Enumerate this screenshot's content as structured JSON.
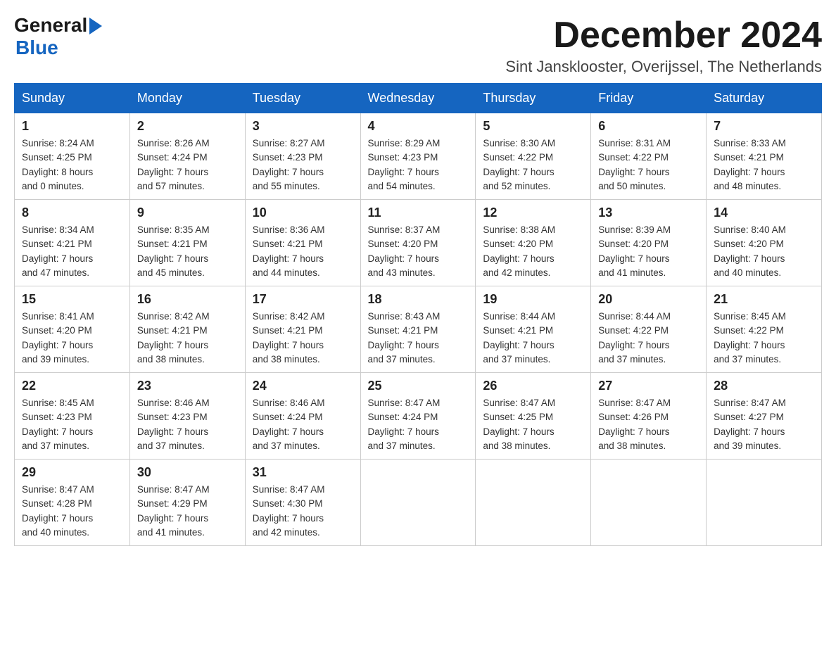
{
  "header": {
    "logo_general": "General",
    "logo_blue": "Blue",
    "month_title": "December 2024",
    "subtitle": "Sint Jansklooster, Overijssel, The Netherlands"
  },
  "days_of_week": [
    "Sunday",
    "Monday",
    "Tuesday",
    "Wednesday",
    "Thursday",
    "Friday",
    "Saturday"
  ],
  "weeks": [
    [
      {
        "day": "1",
        "sunrise": "8:24 AM",
        "sunset": "4:25 PM",
        "daylight": "8 hours and 0 minutes."
      },
      {
        "day": "2",
        "sunrise": "8:26 AM",
        "sunset": "4:24 PM",
        "daylight": "7 hours and 57 minutes."
      },
      {
        "day": "3",
        "sunrise": "8:27 AM",
        "sunset": "4:23 PM",
        "daylight": "7 hours and 55 minutes."
      },
      {
        "day": "4",
        "sunrise": "8:29 AM",
        "sunset": "4:23 PM",
        "daylight": "7 hours and 54 minutes."
      },
      {
        "day": "5",
        "sunrise": "8:30 AM",
        "sunset": "4:22 PM",
        "daylight": "7 hours and 52 minutes."
      },
      {
        "day": "6",
        "sunrise": "8:31 AM",
        "sunset": "4:22 PM",
        "daylight": "7 hours and 50 minutes."
      },
      {
        "day": "7",
        "sunrise": "8:33 AM",
        "sunset": "4:21 PM",
        "daylight": "7 hours and 48 minutes."
      }
    ],
    [
      {
        "day": "8",
        "sunrise": "8:34 AM",
        "sunset": "4:21 PM",
        "daylight": "7 hours and 47 minutes."
      },
      {
        "day": "9",
        "sunrise": "8:35 AM",
        "sunset": "4:21 PM",
        "daylight": "7 hours and 45 minutes."
      },
      {
        "day": "10",
        "sunrise": "8:36 AM",
        "sunset": "4:21 PM",
        "daylight": "7 hours and 44 minutes."
      },
      {
        "day": "11",
        "sunrise": "8:37 AM",
        "sunset": "4:20 PM",
        "daylight": "7 hours and 43 minutes."
      },
      {
        "day": "12",
        "sunrise": "8:38 AM",
        "sunset": "4:20 PM",
        "daylight": "7 hours and 42 minutes."
      },
      {
        "day": "13",
        "sunrise": "8:39 AM",
        "sunset": "4:20 PM",
        "daylight": "7 hours and 41 minutes."
      },
      {
        "day": "14",
        "sunrise": "8:40 AM",
        "sunset": "4:20 PM",
        "daylight": "7 hours and 40 minutes."
      }
    ],
    [
      {
        "day": "15",
        "sunrise": "8:41 AM",
        "sunset": "4:20 PM",
        "daylight": "7 hours and 39 minutes."
      },
      {
        "day": "16",
        "sunrise": "8:42 AM",
        "sunset": "4:21 PM",
        "daylight": "7 hours and 38 minutes."
      },
      {
        "day": "17",
        "sunrise": "8:42 AM",
        "sunset": "4:21 PM",
        "daylight": "7 hours and 38 minutes."
      },
      {
        "day": "18",
        "sunrise": "8:43 AM",
        "sunset": "4:21 PM",
        "daylight": "7 hours and 37 minutes."
      },
      {
        "day": "19",
        "sunrise": "8:44 AM",
        "sunset": "4:21 PM",
        "daylight": "7 hours and 37 minutes."
      },
      {
        "day": "20",
        "sunrise": "8:44 AM",
        "sunset": "4:22 PM",
        "daylight": "7 hours and 37 minutes."
      },
      {
        "day": "21",
        "sunrise": "8:45 AM",
        "sunset": "4:22 PM",
        "daylight": "7 hours and 37 minutes."
      }
    ],
    [
      {
        "day": "22",
        "sunrise": "8:45 AM",
        "sunset": "4:23 PM",
        "daylight": "7 hours and 37 minutes."
      },
      {
        "day": "23",
        "sunrise": "8:46 AM",
        "sunset": "4:23 PM",
        "daylight": "7 hours and 37 minutes."
      },
      {
        "day": "24",
        "sunrise": "8:46 AM",
        "sunset": "4:24 PM",
        "daylight": "7 hours and 37 minutes."
      },
      {
        "day": "25",
        "sunrise": "8:47 AM",
        "sunset": "4:24 PM",
        "daylight": "7 hours and 37 minutes."
      },
      {
        "day": "26",
        "sunrise": "8:47 AM",
        "sunset": "4:25 PM",
        "daylight": "7 hours and 38 minutes."
      },
      {
        "day": "27",
        "sunrise": "8:47 AM",
        "sunset": "4:26 PM",
        "daylight": "7 hours and 38 minutes."
      },
      {
        "day": "28",
        "sunrise": "8:47 AM",
        "sunset": "4:27 PM",
        "daylight": "7 hours and 39 minutes."
      }
    ],
    [
      {
        "day": "29",
        "sunrise": "8:47 AM",
        "sunset": "4:28 PM",
        "daylight": "7 hours and 40 minutes."
      },
      {
        "day": "30",
        "sunrise": "8:47 AM",
        "sunset": "4:29 PM",
        "daylight": "7 hours and 41 minutes."
      },
      {
        "day": "31",
        "sunrise": "8:47 AM",
        "sunset": "4:30 PM",
        "daylight": "7 hours and 42 minutes."
      },
      null,
      null,
      null,
      null
    ]
  ],
  "labels": {
    "sunrise": "Sunrise:",
    "sunset": "Sunset:",
    "daylight": "Daylight:"
  }
}
